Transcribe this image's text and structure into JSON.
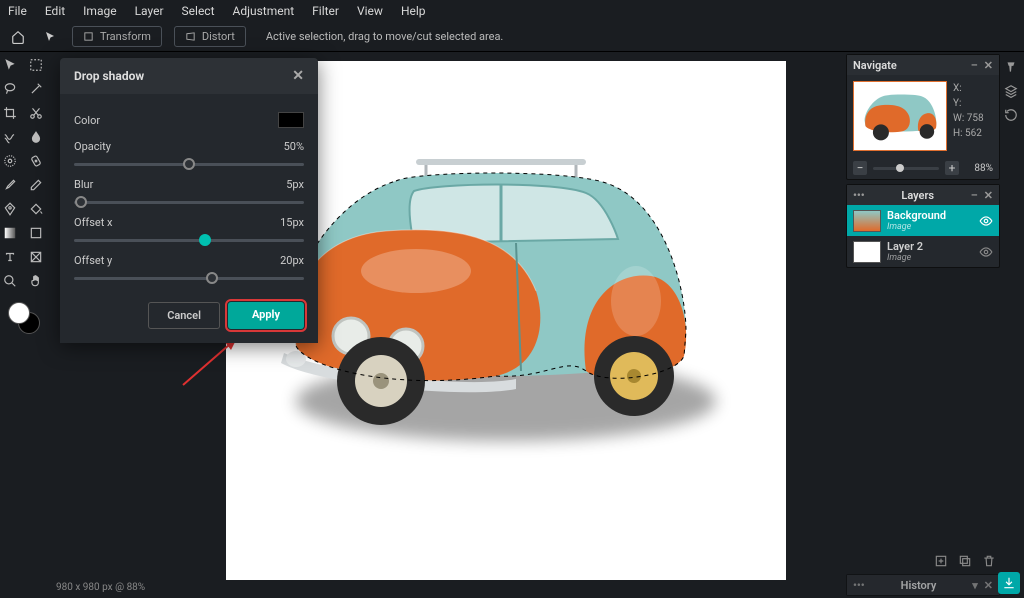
{
  "menu": {
    "file": "File",
    "edit": "Edit",
    "image": "Image",
    "layer": "Layer",
    "select": "Select",
    "adjustment": "Adjustment",
    "filter": "Filter",
    "view": "View",
    "help": "Help"
  },
  "toolbar": {
    "transform": "Transform",
    "distort": "Distort",
    "hint": "Active selection, drag to move/cut selected area."
  },
  "dialog": {
    "title": "Drop shadow",
    "color_label": "Color",
    "opacity_label": "Opacity",
    "opacity_value": "50%",
    "blur_label": "Blur",
    "blur_value": "5px",
    "ox_label": "Offset x",
    "ox_value": "15px",
    "oy_label": "Offset y",
    "oy_value": "20px",
    "cancel": "Cancel",
    "apply": "Apply"
  },
  "navigate": {
    "title": "Navigate",
    "x": "X:",
    "y": "Y:",
    "w": "W:",
    "h": "H:",
    "wval": "758",
    "hval": "562",
    "zoom": "88%"
  },
  "layers": {
    "title": "Layers",
    "items": [
      {
        "name": "Background",
        "sub": "Image"
      },
      {
        "name": "Layer 2",
        "sub": "Image"
      }
    ]
  },
  "history": {
    "title": "History"
  },
  "status": "980 x 980 px @ 88%"
}
